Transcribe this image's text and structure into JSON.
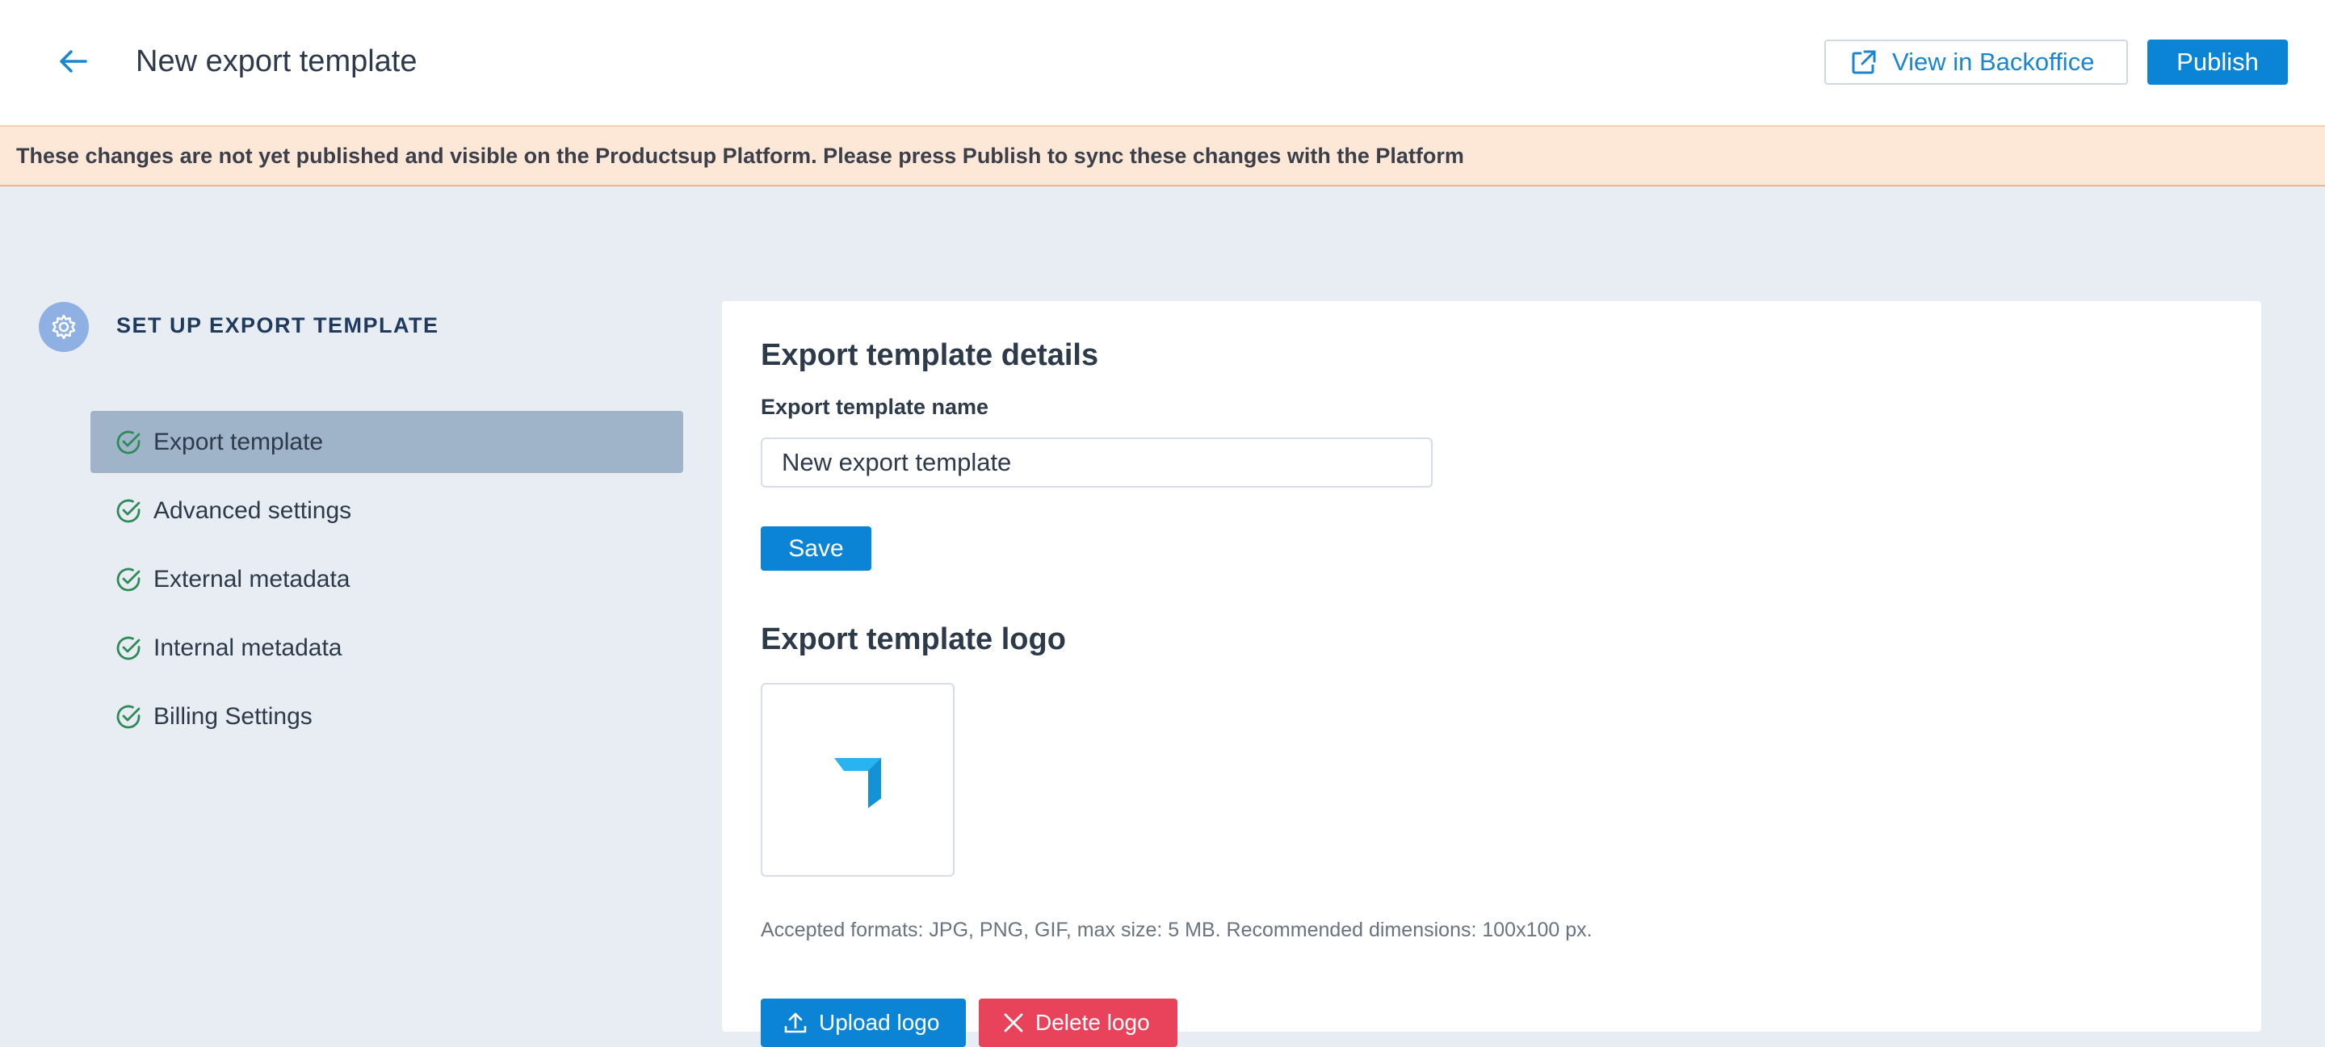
{
  "header": {
    "title": "New export template",
    "back_icon": "arrow-left-icon",
    "view_backoffice_label": "View in Backoffice",
    "view_backoffice_icon": "external-link-icon",
    "publish_label": "Publish"
  },
  "banner": {
    "text": "These changes are not yet published and visible on the Productsup Platform. Please press Publish to sync these changes with the Platform"
  },
  "sidebar": {
    "section_title": "SET UP EXPORT TEMPLATE",
    "section_icon": "gear-icon",
    "items": [
      {
        "label": "Export template",
        "active": true,
        "icon": "check-circle-icon"
      },
      {
        "label": "Advanced settings",
        "active": false,
        "icon": "check-circle-icon"
      },
      {
        "label": "External metadata",
        "active": false,
        "icon": "check-circle-icon"
      },
      {
        "label": "Internal metadata",
        "active": false,
        "icon": "check-circle-icon"
      },
      {
        "label": "Billing Settings",
        "active": false,
        "icon": "check-circle-icon"
      }
    ]
  },
  "main": {
    "details_title": "Export template details",
    "name_label": "Export template name",
    "name_value": "New export template",
    "save_label": "Save",
    "logo_title": "Export template logo",
    "logo_icon": "productsup-logo-icon",
    "logo_help": "Accepted formats: JPG, PNG, GIF, max size: 5 MB. Recommended dimensions: 100x100 px.",
    "upload_label": "Upload logo",
    "upload_icon": "upload-icon",
    "delete_label": "Delete logo",
    "delete_icon": "close-icon"
  },
  "colors": {
    "primary": "#0b84d6",
    "danger": "#e8435b",
    "banner_bg": "#fde8d8",
    "page_bg": "#e8ecf3",
    "nav_active_bg": "#9fb3c9",
    "check_green": "#2e8b57"
  }
}
